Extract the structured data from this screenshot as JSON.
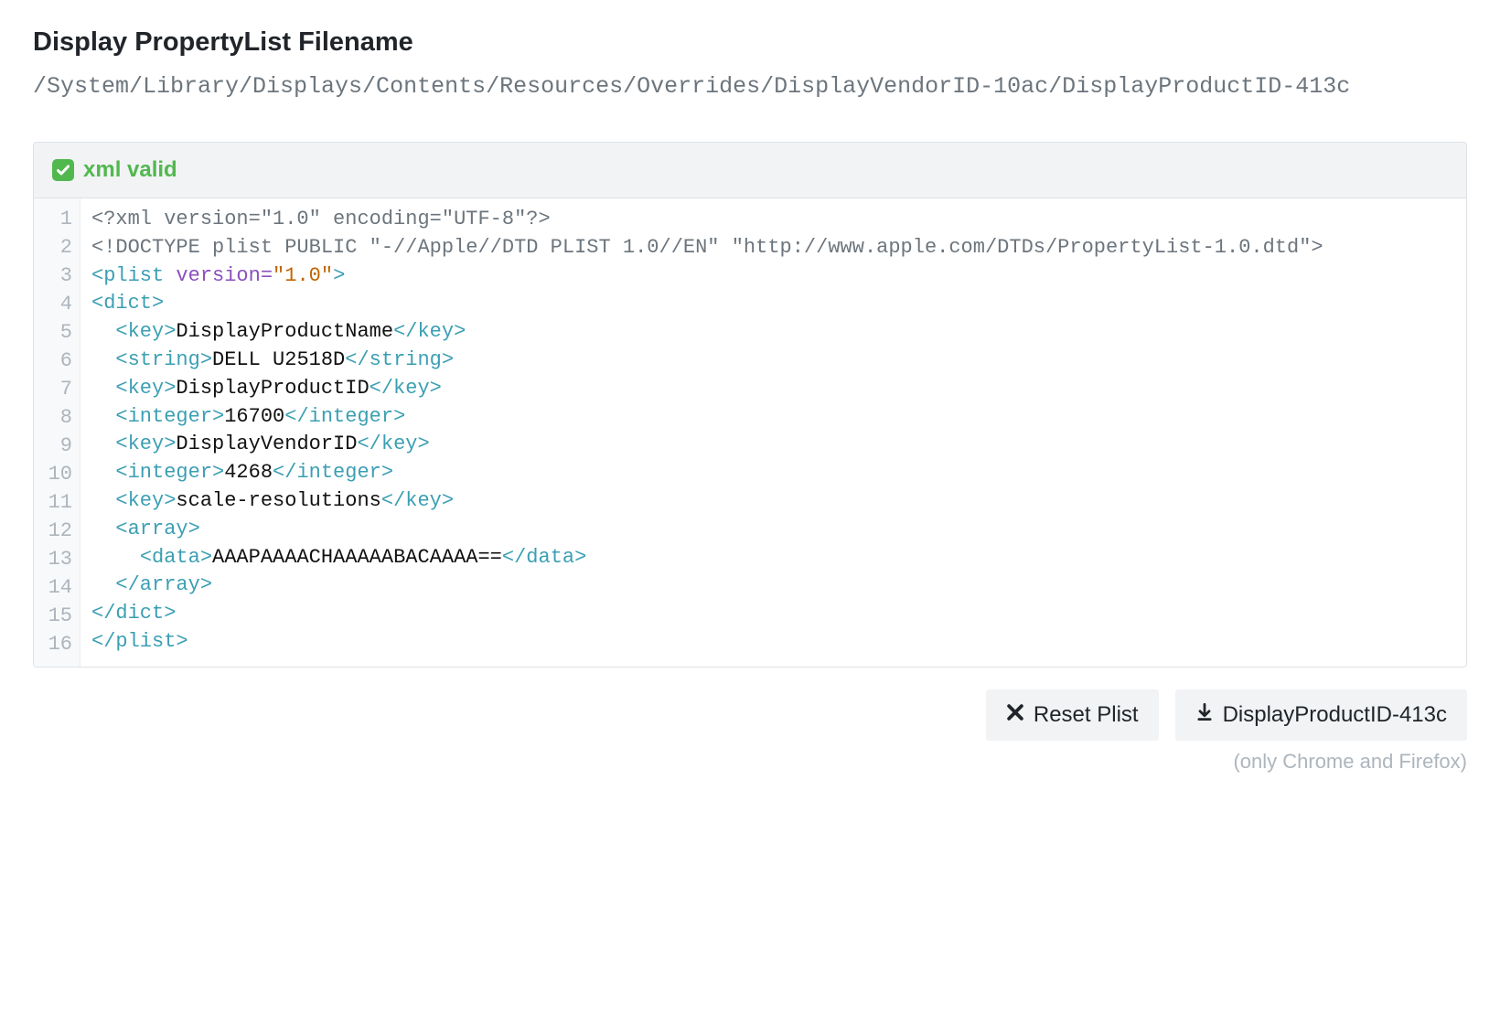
{
  "header": {
    "title": "Display PropertyList Filename",
    "path": "/System/Library/Displays/Contents/Resources/Overrides/DisplayVendorID-10ac/DisplayProductID-413c"
  },
  "status": {
    "text": "xml valid"
  },
  "code": {
    "lines": [
      [
        {
          "cls": "tok-decl",
          "t": "<?xml version=\"1.0\" encoding=\"UTF-8\"?>"
        }
      ],
      [
        {
          "cls": "tok-decl",
          "t": "<!DOCTYPE plist PUBLIC \"-//Apple//DTD PLIST 1.0//EN\" \"http://www.apple.com/DTDs/PropertyList-1.0.dtd\">"
        }
      ],
      [
        {
          "cls": "tok-tag",
          "t": "<plist "
        },
        {
          "cls": "tok-attr",
          "t": "version="
        },
        {
          "cls": "tok-str",
          "t": "\"1.0\""
        },
        {
          "cls": "tok-tag",
          "t": ">"
        }
      ],
      [
        {
          "cls": "tok-tag",
          "t": "<dict>"
        }
      ],
      [
        {
          "cls": "",
          "t": "  "
        },
        {
          "cls": "tok-tag",
          "t": "<key>"
        },
        {
          "cls": "tok-text",
          "t": "DisplayProductName"
        },
        {
          "cls": "tok-tag",
          "t": "</key>"
        }
      ],
      [
        {
          "cls": "",
          "t": "  "
        },
        {
          "cls": "tok-tag",
          "t": "<string>"
        },
        {
          "cls": "tok-text",
          "t": "DELL U2518D"
        },
        {
          "cls": "tok-tag",
          "t": "</string>"
        }
      ],
      [
        {
          "cls": "",
          "t": "  "
        },
        {
          "cls": "tok-tag",
          "t": "<key>"
        },
        {
          "cls": "tok-text",
          "t": "DisplayProductID"
        },
        {
          "cls": "tok-tag",
          "t": "</key>"
        }
      ],
      [
        {
          "cls": "",
          "t": "  "
        },
        {
          "cls": "tok-tag",
          "t": "<integer>"
        },
        {
          "cls": "tok-text",
          "t": "16700"
        },
        {
          "cls": "tok-tag",
          "t": "</integer>"
        }
      ],
      [
        {
          "cls": "",
          "t": "  "
        },
        {
          "cls": "tok-tag",
          "t": "<key>"
        },
        {
          "cls": "tok-text",
          "t": "DisplayVendorID"
        },
        {
          "cls": "tok-tag",
          "t": "</key>"
        }
      ],
      [
        {
          "cls": "",
          "t": "  "
        },
        {
          "cls": "tok-tag",
          "t": "<integer>"
        },
        {
          "cls": "tok-text",
          "t": "4268"
        },
        {
          "cls": "tok-tag",
          "t": "</integer>"
        }
      ],
      [
        {
          "cls": "",
          "t": "  "
        },
        {
          "cls": "tok-tag",
          "t": "<key>"
        },
        {
          "cls": "tok-text",
          "t": "scale-resolutions"
        },
        {
          "cls": "tok-tag",
          "t": "</key>"
        }
      ],
      [
        {
          "cls": "",
          "t": "  "
        },
        {
          "cls": "tok-tag",
          "t": "<array>"
        }
      ],
      [
        {
          "cls": "",
          "t": "    "
        },
        {
          "cls": "tok-tag",
          "t": "<data>"
        },
        {
          "cls": "tok-text",
          "t": "AAAPAAAACHAAAAABACAAAA=="
        },
        {
          "cls": "tok-tag",
          "t": "</data>"
        }
      ],
      [
        {
          "cls": "",
          "t": "  "
        },
        {
          "cls": "tok-tag",
          "t": "</array>"
        }
      ],
      [
        {
          "cls": "tok-tag",
          "t": "</dict>"
        }
      ],
      [
        {
          "cls": "tok-tag",
          "t": "</plist>"
        }
      ]
    ]
  },
  "actions": {
    "reset_label": "Reset Plist",
    "download_label": "DisplayProductID-413c",
    "note": "(only Chrome and Firefox)"
  }
}
